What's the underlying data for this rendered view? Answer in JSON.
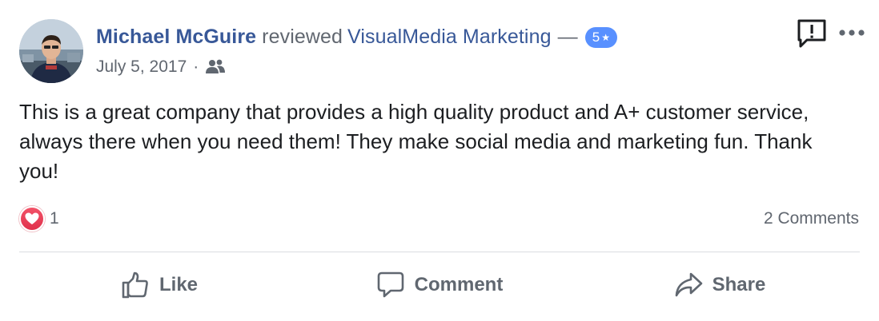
{
  "review": {
    "author": "Michael McGuire",
    "verb": "reviewed",
    "page": "VisualMedia Marketing",
    "dash": "—",
    "rating": "5",
    "star": "★",
    "date": "July 5, 2017",
    "separator": "·",
    "audience_icon": "friends-icon",
    "text": "This is a great company that provides a high quality product and A+ customer service, always there when you need them! They make social media and marketing fun. Thank you!"
  },
  "engagement": {
    "reaction_icon": "heart-icon",
    "reaction_count": "1",
    "comments": "2 Comments"
  },
  "actions": {
    "like": "Like",
    "comment": "Comment",
    "share": "Share"
  },
  "colors": {
    "link": "#385898",
    "badge": "#5890ff",
    "heart": "#e0314b",
    "muted": "#616770"
  }
}
